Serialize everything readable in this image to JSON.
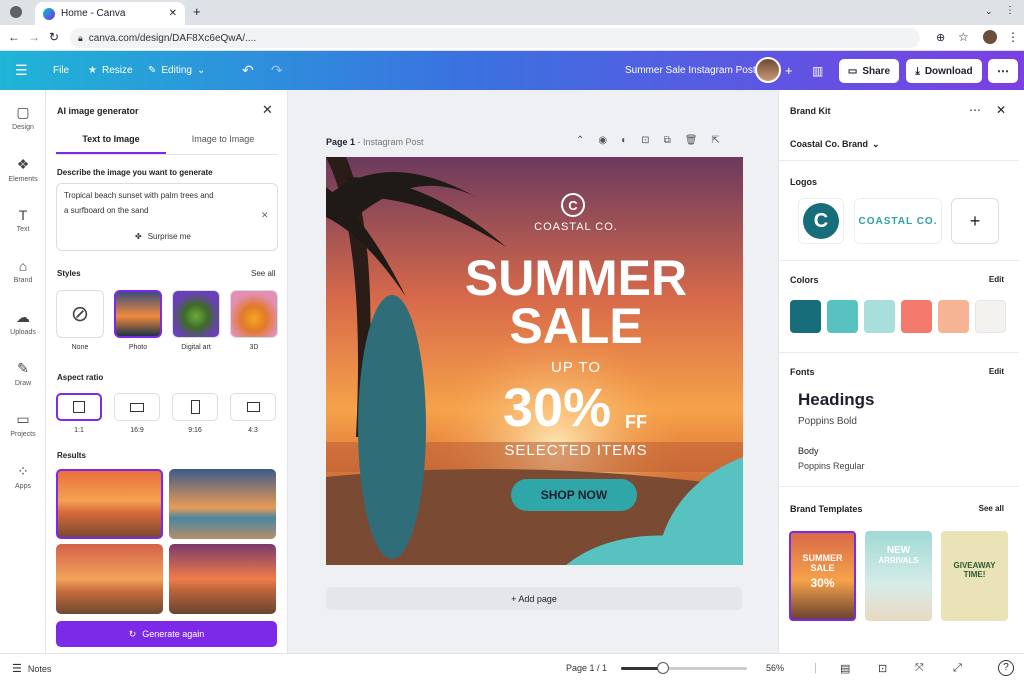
{
  "browser": {
    "tab_title": "Home - Canva",
    "url": "canva.com/design/DAF8Xc6eQwA/...."
  },
  "toolbar": {
    "file": "File",
    "resize": "Resize",
    "editing": "Editing",
    "doc_title": "Summer Sale Instagram Post",
    "share": "Share",
    "download": "Download"
  },
  "rail": [
    {
      "label": "Design",
      "icon": "design-icon",
      "glyph": "▢"
    },
    {
      "label": "Elements",
      "icon": "elements-icon",
      "glyph": "❖"
    },
    {
      "label": "Text",
      "icon": "text-icon",
      "glyph": "T"
    },
    {
      "label": "Brand",
      "icon": "brand-icon",
      "glyph": "⌂"
    },
    {
      "label": "Uploads",
      "icon": "uploads-icon",
      "glyph": "☁"
    },
    {
      "label": "Draw",
      "icon": "draw-icon",
      "glyph": "✎"
    },
    {
      "label": "Projects",
      "icon": "projects-icon",
      "glyph": "▭"
    },
    {
      "label": "Apps",
      "icon": "apps-icon",
      "glyph": "⁘"
    }
  ],
  "ai_panel": {
    "title": "AI image generator",
    "tabs": [
      "Text to Image",
      "Image to Image"
    ],
    "describe_label": "Describe the image you want to generate",
    "prompt_line1": "Tropical beach sunset with palm trees and",
    "prompt_line2": "a surfboard on the sand",
    "surprise": "Surprise me",
    "styles_label": "Styles",
    "see_all": "See all",
    "styles": [
      "None",
      "Photo",
      "Digital art",
      "3D"
    ],
    "aspect_label": "Aspect ratio",
    "aspects": [
      "1:1",
      "16:9",
      "9:16",
      "4:3"
    ],
    "results_label": "Results",
    "generate_again": "Generate again"
  },
  "canvas": {
    "page_label": "Page 1",
    "page_type": "Instagram Post",
    "brand_name": "COASTAL CO.",
    "headline1": "SUMMER",
    "headline2": "SALE",
    "up_to": "UP TO",
    "percent": "30%",
    "off": "FF",
    "selected": "SELECTED ITEMS",
    "cta": "SHOP NOW",
    "add_page": "+ Add page"
  },
  "brand_kit": {
    "title": "Brand Kit",
    "brand": "Coastal Co. Brand",
    "logos_label": "Logos",
    "logo_wordmark": "COASTAL CO.",
    "colors_label": "Colors",
    "edit": "Edit",
    "colors": [
      "#176e7a",
      "#58c2c1",
      "#a8dfdc",
      "#f47a6b",
      "#f6b495",
      "#f3f2ee"
    ],
    "fonts_label": "Fonts",
    "heading_font": "Headings",
    "heading_font_name": "Poppins Bold",
    "body_font": "Body",
    "body_font_name": "Poppins Regular",
    "templates_label": "Brand Templates",
    "see_all": "See all",
    "t1_line1": "SUMMER",
    "t1_line2": "SALE",
    "t1_pct": "30%",
    "t2_line1": "NEW",
    "t2_line2": "ARRIVALS",
    "t3_line1": "GIVEAWAY",
    "t3_line2": "TIME!"
  },
  "bottom": {
    "notes": "Notes",
    "page": "Page 1 / 1",
    "zoom_percent": 56,
    "zoom": "56%"
  }
}
